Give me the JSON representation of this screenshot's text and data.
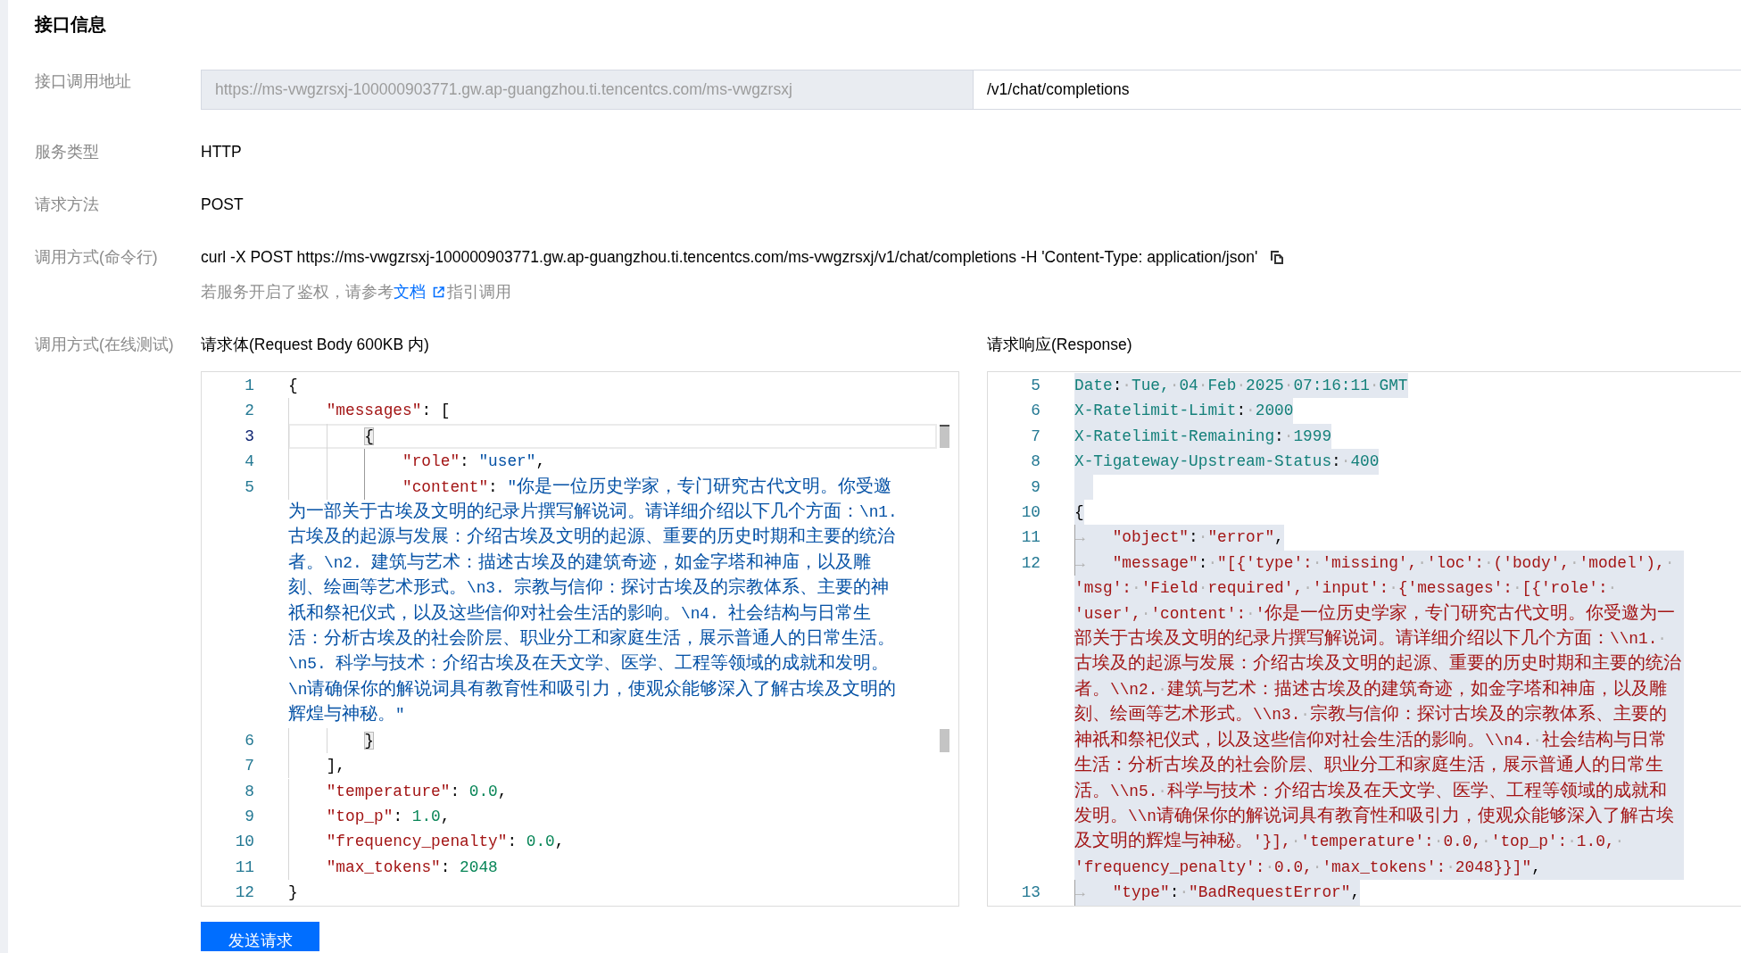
{
  "title": "接口信息",
  "fields": [
    {
      "kind": "url",
      "label": "接口调用地址",
      "base": {
        "value": "https://ms-vwgzrsxj-100000903771.gw.ap-guangzhou.ti.tencentcs.com/ms-vwgzrsxj",
        "disabled": true
      },
      "path": {
        "value": "/v1/chat/completions",
        "disabled": false
      }
    },
    {
      "kind": "text",
      "label": "服务类型",
      "value": "HTTP"
    },
    {
      "kind": "text",
      "label": "请求方法",
      "value": "POST"
    },
    {
      "kind": "command",
      "label": "调用方式(命令行)",
      "value": "curl -X POST https://ms-vwgzrsxj-100000903771.gw.ap-guangzhou.ti.tencentcs.com/ms-vwgzrsxj/v1/chat/completions -H 'Content-Type: application/json'",
      "hint": {
        "before": "若服务开启了鉴权，请参考",
        "link": "文档",
        "after": "指引调用"
      }
    }
  ],
  "online_test": {
    "label": "调用方式(在线测试)",
    "request": {
      "title": "请求体(Request Body 600KB 内)",
      "lines": [
        {
          "number": "1",
          "current": false,
          "bracket_match": false,
          "tokens": [
            {
              "kind": "punct",
              "text": "{"
            }
          ]
        },
        {
          "number": "2",
          "current": false,
          "bracket_match": false,
          "tokens": [
            {
              "kind": "key",
              "text": "    \"messages\""
            },
            {
              "kind": "punct",
              "text": ": ["
            }
          ]
        },
        {
          "number": "3",
          "current": true,
          "bracket_match": true,
          "tokens": [
            {
              "kind": "punct",
              "text": "        {"
            }
          ]
        },
        {
          "number": "4",
          "current": false,
          "bracket_match": false,
          "tokens": [
            {
              "kind": "key",
              "text": "            \"role\""
            },
            {
              "kind": "punct",
              "text": ": "
            },
            {
              "kind": "string",
              "text": "\"user\""
            },
            {
              "kind": "punct",
              "text": ","
            }
          ]
        },
        {
          "number": "5",
          "current": false,
          "bracket_match": false,
          "tokens": [
            {
              "kind": "key",
              "text": "            \"content\""
            },
            {
              "kind": "punct",
              "text": ": "
            },
            {
              "kind": "string",
              "text": "\"你是一位历史学家，专门研究古代文明。你受邀为一部关于古埃及文明的纪录片撰写解说词。请详细介绍以下几个方面：\\n1. 古埃及的起源与发展：介绍古埃及文明的起源、重要的历史时期和主要的统治者。\\n2. 建筑与艺术：描述古埃及的建筑奇迹，如金字塔和神庙，以及雕刻、绘画等艺术形式。\\n3. 宗教与信仰：探讨古埃及的宗教体系、主要的神祇和祭祀仪式，以及这些信仰对社会生活的影响。\\n4. 社会结构与日常生活：分析古埃及的社会阶层、职业分工和家庭生活，展示普通人的日常生活。\\n5. 科学与技术：介绍古埃及在天文学、医学、工程等领域的成就和发明。\\n请确保你的解说词具有教育性和吸引力，使观众能够深入了解古埃及文明的辉煌与神秘。\""
            }
          ]
        },
        {
          "number": "6",
          "current": false,
          "bracket_match": true,
          "tokens": [
            {
              "kind": "punct",
              "text": "        }"
            }
          ]
        },
        {
          "number": "7",
          "current": false,
          "bracket_match": false,
          "tokens": [
            {
              "kind": "punct",
              "text": "    ],"
            }
          ]
        },
        {
          "number": "8",
          "current": false,
          "bracket_match": false,
          "tokens": [
            {
              "kind": "key",
              "text": "    \"temperature\""
            },
            {
              "kind": "punct",
              "text": ": "
            },
            {
              "kind": "number",
              "text": "0.0"
            },
            {
              "kind": "punct",
              "text": ","
            }
          ]
        },
        {
          "number": "9",
          "current": false,
          "bracket_match": false,
          "tokens": [
            {
              "kind": "key",
              "text": "    \"top_p\""
            },
            {
              "kind": "punct",
              "text": ": "
            },
            {
              "kind": "number",
              "text": "1.0"
            },
            {
              "kind": "punct",
              "text": ","
            }
          ]
        },
        {
          "number": "10",
          "current": false,
          "bracket_match": false,
          "tokens": [
            {
              "kind": "key",
              "text": "    \"frequency_penalty\""
            },
            {
              "kind": "punct",
              "text": ": "
            },
            {
              "kind": "number",
              "text": "0.0"
            },
            {
              "kind": "punct",
              "text": ","
            }
          ]
        },
        {
          "number": "11",
          "current": false,
          "bracket_match": false,
          "tokens": [
            {
              "kind": "key",
              "text": "    \"max_tokens\""
            },
            {
              "kind": "punct",
              "text": ": "
            },
            {
              "kind": "number",
              "text": "2048"
            }
          ]
        },
        {
          "number": "12",
          "current": false,
          "bracket_match": false,
          "tokens": [
            {
              "kind": "punct",
              "text": "}"
            }
          ]
        }
      ]
    },
    "response": {
      "title": "请求响应(Response)",
      "lines": [
        {
          "number": "5",
          "selected": true,
          "tokens": [
            {
              "kind": "header",
              "text": "Date"
            },
            {
              "kind": "punct",
              "text": ":"
            },
            {
              "kind": "ws",
              "text": "·"
            },
            {
              "kind": "header",
              "text": "Tue,"
            },
            {
              "kind": "ws",
              "text": "·"
            },
            {
              "kind": "header",
              "text": "04"
            },
            {
              "kind": "ws",
              "text": "·"
            },
            {
              "kind": "header",
              "text": "Feb"
            },
            {
              "kind": "ws",
              "text": "·"
            },
            {
              "kind": "header",
              "text": "2025"
            },
            {
              "kind": "ws",
              "text": "·"
            },
            {
              "kind": "header",
              "text": "07:16:11"
            },
            {
              "kind": "ws",
              "text": "·"
            },
            {
              "kind": "header",
              "text": "GMT"
            }
          ]
        },
        {
          "number": "6",
          "selected": true,
          "tokens": [
            {
              "kind": "header",
              "text": "X-Ratelimit-Limit"
            },
            {
              "kind": "punct",
              "text": ":"
            },
            {
              "kind": "ws",
              "text": "·"
            },
            {
              "kind": "header",
              "text": "2000"
            }
          ]
        },
        {
          "number": "7",
          "selected": true,
          "tokens": [
            {
              "kind": "header",
              "text": "X-Ratelimit-Remaining"
            },
            {
              "kind": "punct",
              "text": ":"
            },
            {
              "kind": "ws",
              "text": "·"
            },
            {
              "kind": "header",
              "text": "1999"
            }
          ]
        },
        {
          "number": "8",
          "selected": true,
          "tokens": [
            {
              "kind": "header",
              "text": "X-Tigateway-Upstream-Status"
            },
            {
              "kind": "punct",
              "text": ":"
            },
            {
              "kind": "ws",
              "text": "·"
            },
            {
              "kind": "header",
              "text": "400"
            }
          ]
        },
        {
          "number": "9",
          "selected": true
        },
        {
          "number": "10",
          "selected": true,
          "tokens": [
            {
              "kind": "punct",
              "text": "{"
            }
          ]
        },
        {
          "number": "11",
          "selected": true,
          "tokens": [
            {
              "kind": "tab",
              "text": "→"
            },
            {
              "kind": "json",
              "text": "\"object\""
            },
            {
              "kind": "punct",
              "text": ":"
            },
            {
              "kind": "ws",
              "text": "·"
            },
            {
              "kind": "json",
              "text": "\"error\""
            },
            {
              "kind": "punct",
              "text": ","
            }
          ]
        },
        {
          "number": "12",
          "selected": true,
          "tokens": [
            {
              "kind": "tab",
              "text": "→"
            },
            {
              "kind": "json",
              "text": "\"message\""
            },
            {
              "kind": "punct",
              "text": ":"
            },
            {
              "kind": "ws",
              "text": "·"
            },
            {
              "kind": "json",
              "text": "\"[{'type':"
            },
            {
              "kind": "ws",
              "text": "·"
            },
            {
              "kind": "json",
              "text": "'missing',"
            },
            {
              "kind": "ws",
              "text": "·"
            },
            {
              "kind": "json",
              "text": "'loc':"
            },
            {
              "kind": "ws",
              "text": "·"
            },
            {
              "kind": "json",
              "text": "('body',"
            },
            {
              "kind": "ws",
              "text": "·"
            },
            {
              "kind": "json",
              "text": "'model'),"
            },
            {
              "kind": "ws",
              "text": "·"
            },
            {
              "kind": "json",
              "text": "'msg':"
            },
            {
              "kind": "ws",
              "text": "·"
            },
            {
              "kind": "json",
              "text": "'Field"
            },
            {
              "kind": "ws",
              "text": "·"
            },
            {
              "kind": "json",
              "text": "required',"
            },
            {
              "kind": "ws",
              "text": "·"
            },
            {
              "kind": "json",
              "text": "'input':"
            },
            {
              "kind": "ws",
              "text": "·"
            },
            {
              "kind": "json",
              "text": "{'messages':"
            },
            {
              "kind": "ws",
              "text": "·"
            },
            {
              "kind": "json",
              "text": "[{'role':"
            },
            {
              "kind": "ws",
              "text": "·"
            },
            {
              "kind": "json",
              "text": "'user',"
            },
            {
              "kind": "ws",
              "text": "·"
            },
            {
              "kind": "json",
              "text": "'content':"
            },
            {
              "kind": "ws",
              "text": "·"
            },
            {
              "kind": "json",
              "text": "'你是一位历史学家，专门研究古代文明。你受邀为一部关于古埃及文明的纪录片撰写解说词。请详细介绍以下几个方面：\\\\n1."
            },
            {
              "kind": "ws",
              "text": "·"
            },
            {
              "kind": "json",
              "text": "古埃及的起源与发展：介绍古埃及文明的起源、重要的历史时期和主要的统治者。\\\\n2."
            },
            {
              "kind": "ws",
              "text": "·"
            },
            {
              "kind": "json",
              "text": "建筑与艺术：描述古埃及的建筑奇迹，如金字塔和神庙，以及雕刻、绘画等艺术形式。\\\\n3."
            },
            {
              "kind": "ws",
              "text": "·"
            },
            {
              "kind": "json",
              "text": "宗教与信仰：探讨古埃及的宗教体系、主要的神祇和祭祀仪式，以及这些信仰对社会生活的影响。\\\\n4."
            },
            {
              "kind": "ws",
              "text": "·"
            },
            {
              "kind": "json",
              "text": "社会结构与日常生活：分析古埃及的社会阶层、职业分工和家庭生活，展示普通人的日常生活。\\\\n5."
            },
            {
              "kind": "ws",
              "text": "·"
            },
            {
              "kind": "json",
              "text": "科学与技术：介绍古埃及在天文学、医学、工程等领域的成就和发明。\\\\n请确保你的解说词具有教育性和吸引力，使观众能够深入了解古埃及文明的辉煌与神秘。'}],"
            },
            {
              "kind": "ws",
              "text": "·"
            },
            {
              "kind": "json",
              "text": "'temperature':"
            },
            {
              "kind": "ws",
              "text": "·"
            },
            {
              "kind": "json",
              "text": "0.0,"
            },
            {
              "kind": "ws",
              "text": "·"
            },
            {
              "kind": "json",
              "text": "'top_p':"
            },
            {
              "kind": "ws",
              "text": "·"
            },
            {
              "kind": "json",
              "text": "1.0,"
            },
            {
              "kind": "ws",
              "text": "·"
            },
            {
              "kind": "json",
              "text": "'frequency_penalty':"
            },
            {
              "kind": "ws",
              "text": "·"
            },
            {
              "kind": "json",
              "text": "0.0,"
            },
            {
              "kind": "ws",
              "text": "·"
            },
            {
              "kind": "json",
              "text": "'max_tokens':"
            },
            {
              "kind": "ws",
              "text": "·"
            },
            {
              "kind": "json",
              "text": "2048}}]\""
            },
            {
              "kind": "punct",
              "text": ","
            }
          ]
        },
        {
          "number": "13",
          "selected": true,
          "tokens": [
            {
              "kind": "tab",
              "text": "→"
            },
            {
              "kind": "json",
              "text": "\"type\""
            },
            {
              "kind": "punct",
              "text": ":"
            },
            {
              "kind": "ws",
              "text": "·"
            },
            {
              "kind": "json",
              "text": "\"BadRequestError\""
            },
            {
              "kind": "punct",
              "text": ","
            }
          ]
        }
      ]
    },
    "send_button": "发送请求"
  }
}
